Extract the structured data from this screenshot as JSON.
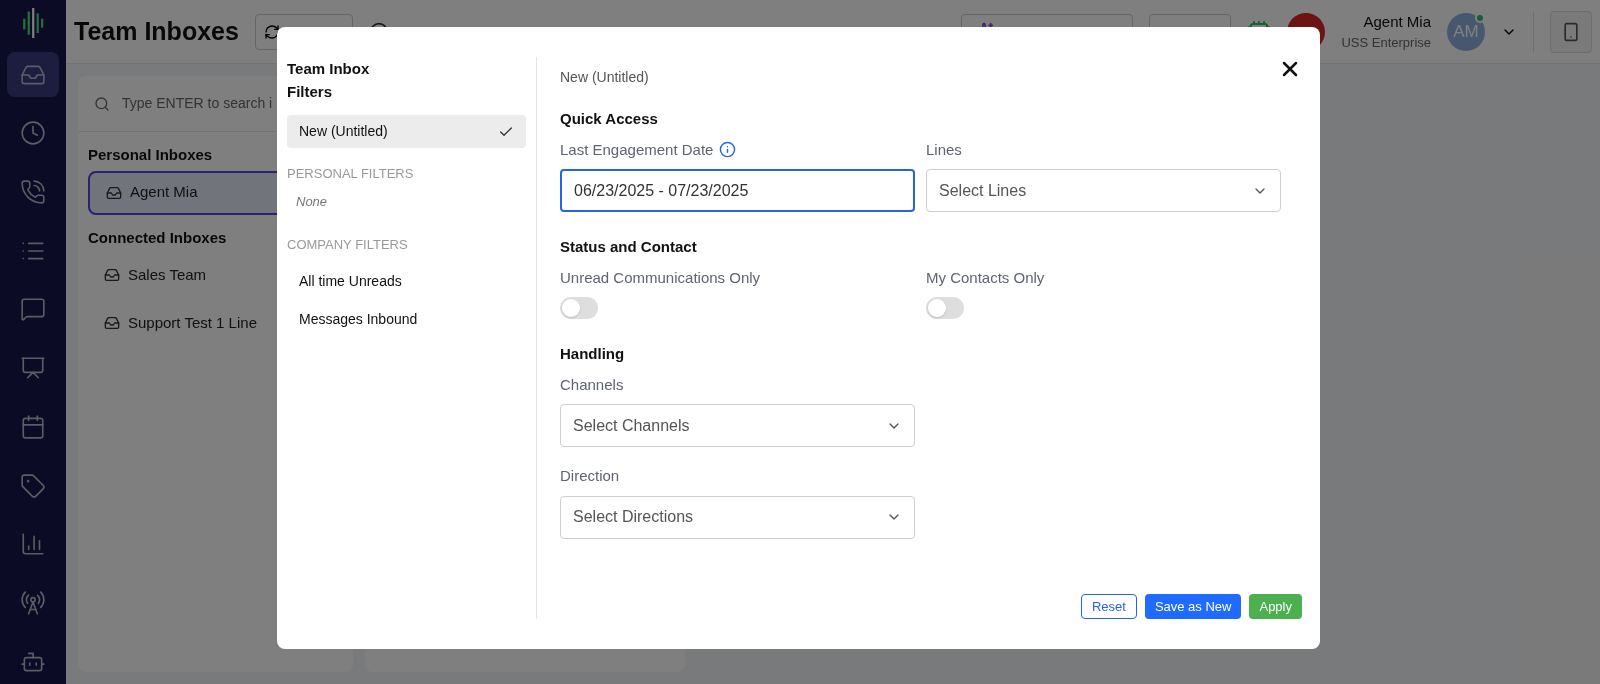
{
  "rail": {
    "items": [
      {
        "selected": true
      },
      {
        "selected": false
      },
      {
        "selected": false
      },
      {
        "selected": false
      },
      {
        "selected": false
      },
      {
        "selected": false
      },
      {
        "selected": false
      },
      {
        "selected": false
      },
      {
        "selected": false
      },
      {
        "selected": false
      },
      {
        "selected": false
      }
    ]
  },
  "header": {
    "title": "Team Inboxes",
    "user": {
      "name": "Agent Mia",
      "org": "USS Enterprise",
      "initials": "AM",
      "online": true
    }
  },
  "inboxes": {
    "search": {
      "placeholder": "Type ENTER to search i"
    },
    "sections": [
      {
        "title": "Personal Inboxes",
        "items": [
          {
            "label": "Agent Mia",
            "selected": true
          }
        ]
      },
      {
        "title": "Connected Inboxes",
        "items": [
          {
            "label": "Sales Team",
            "selected": false
          },
          {
            "label": "Support Test 1 Line",
            "selected": false
          }
        ]
      }
    ]
  },
  "dialog": {
    "sidebar": {
      "title": "Team Inbox Filters",
      "current": [
        {
          "label": "New (Untitled)",
          "selected": true
        }
      ],
      "groups": [
        {
          "heading": "PERSONAL FILTERS",
          "empty_text": "None"
        },
        {
          "heading": "COMPANY FILTERS",
          "items": [
            {
              "label": "All time Unreads",
              "selected": false
            },
            {
              "label": "Messages Inbound",
              "selected": false
            }
          ]
        }
      ]
    },
    "filter_name": "New (Untitled)",
    "sections": [
      {
        "title": "Quick Access",
        "fields": [
          {
            "kind": "date",
            "label": "Last Engagement Date",
            "info": true,
            "value": "06/23/2025 - 07/23/2025",
            "focused": true
          },
          {
            "kind": "select",
            "label": "Lines",
            "placeholder": "Select Lines",
            "focused": false
          }
        ]
      },
      {
        "title": "Status and Contact",
        "fields": [
          {
            "kind": "toggle",
            "label": "Unread Communications Only",
            "on": false
          },
          {
            "kind": "toggle",
            "label": "My Contacts Only",
            "on": false
          }
        ]
      },
      {
        "title": "Handling",
        "fields": [
          {
            "kind": "select",
            "label": "Channels",
            "placeholder": "Select Channels",
            "focused": false
          },
          {
            "kind": "break"
          },
          {
            "kind": "select",
            "label": "Direction",
            "placeholder": "Select Directions",
            "focused": false
          }
        ]
      }
    ],
    "buttons": [
      {
        "kind": "outline",
        "label": "Reset"
      },
      {
        "kind": "primary",
        "label": "Save as New"
      },
      {
        "kind": "success",
        "label": "Apply"
      }
    ]
  }
}
